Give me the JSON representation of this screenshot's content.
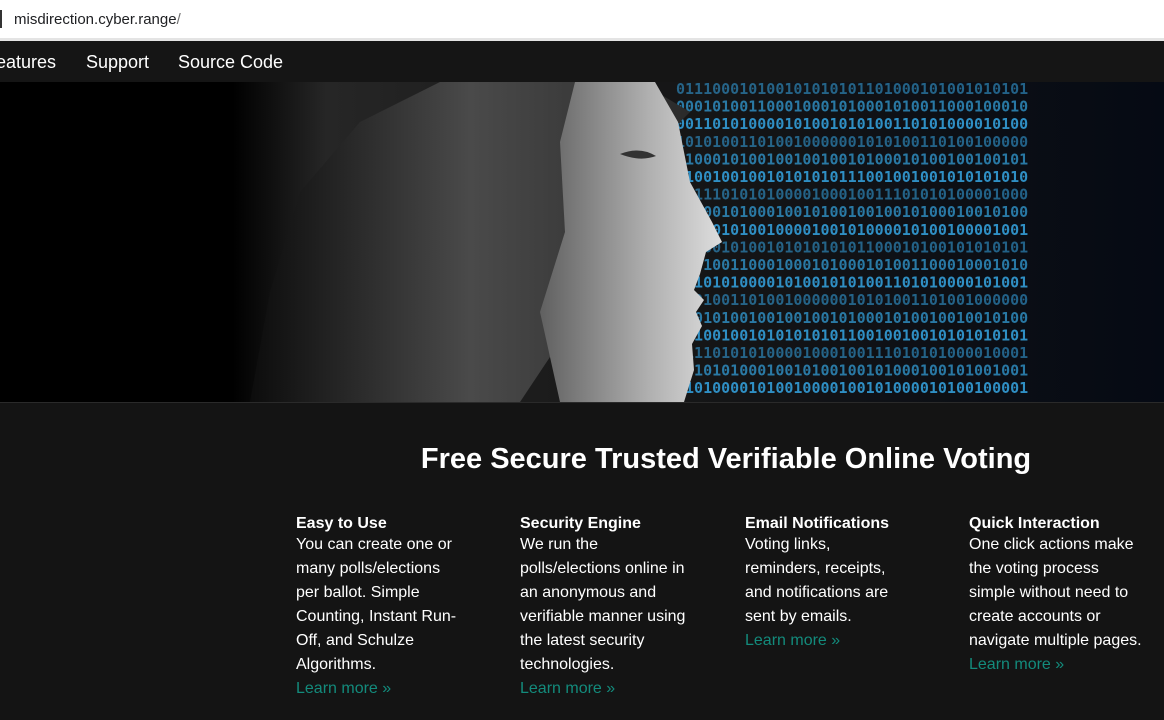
{
  "browser": {
    "url_host": "misdirection.cyber.range",
    "url_slash": "/"
  },
  "nav": {
    "features": "eatures",
    "support": "Support",
    "source_code": "Source Code"
  },
  "hero": {
    "binary_rows": [
      "011100010100101010101101000101001010101",
      "000101001100010001010001010011000100010",
      "001101010000101001010100110101000010100",
      "101010011010010000001010100110100100000",
      "010001010010010010010100010100100100101",
      "110010010010101010111001001001010101010",
      "101110101010000100010011101010100001000",
      "101001010001001010010010010100010010100",
      "100001010010000100101000010100100001001",
      "010001010010101010101100010100101010101",
      "010100110001000101000101001100010001010",
      "111010100001010010101001101010000101001",
      "010100110100100000010101001101001000000",
      "000101001001001001010001010010010010100",
      "001001001010101010110010010010101010101",
      "011101010100001000100111010101000010001",
      "001010100010010100100101000100101001001",
      "010100001010010000100101000010100100001"
    ]
  },
  "main": {
    "headline": "Free Secure Trusted Verifiable Online Voting",
    "features": [
      {
        "title": "Easy to Use",
        "text": "You can create one or many polls/elections per ballot. Simple Counting, Instant Run-Off, and Schulze Algorithms.",
        "link": "Learn more »"
      },
      {
        "title": "Security Engine",
        "text": "We run the polls/elections online in an anonymous and verifiable manner using the latest security technologies.",
        "link": "Learn more »"
      },
      {
        "title": "Email Notifications",
        "text": "Voting links, reminders, receipts, and notifications are sent by emails.",
        "link": "Learn more »"
      },
      {
        "title": "Quick Interaction",
        "text": "One click actions make the voting process simple without need to create accounts or navigate multiple pages.",
        "link": "Learn more »"
      }
    ]
  },
  "colors": {
    "background": "#141414",
    "link": "#138b7c",
    "binary": "#2f8fc4"
  }
}
